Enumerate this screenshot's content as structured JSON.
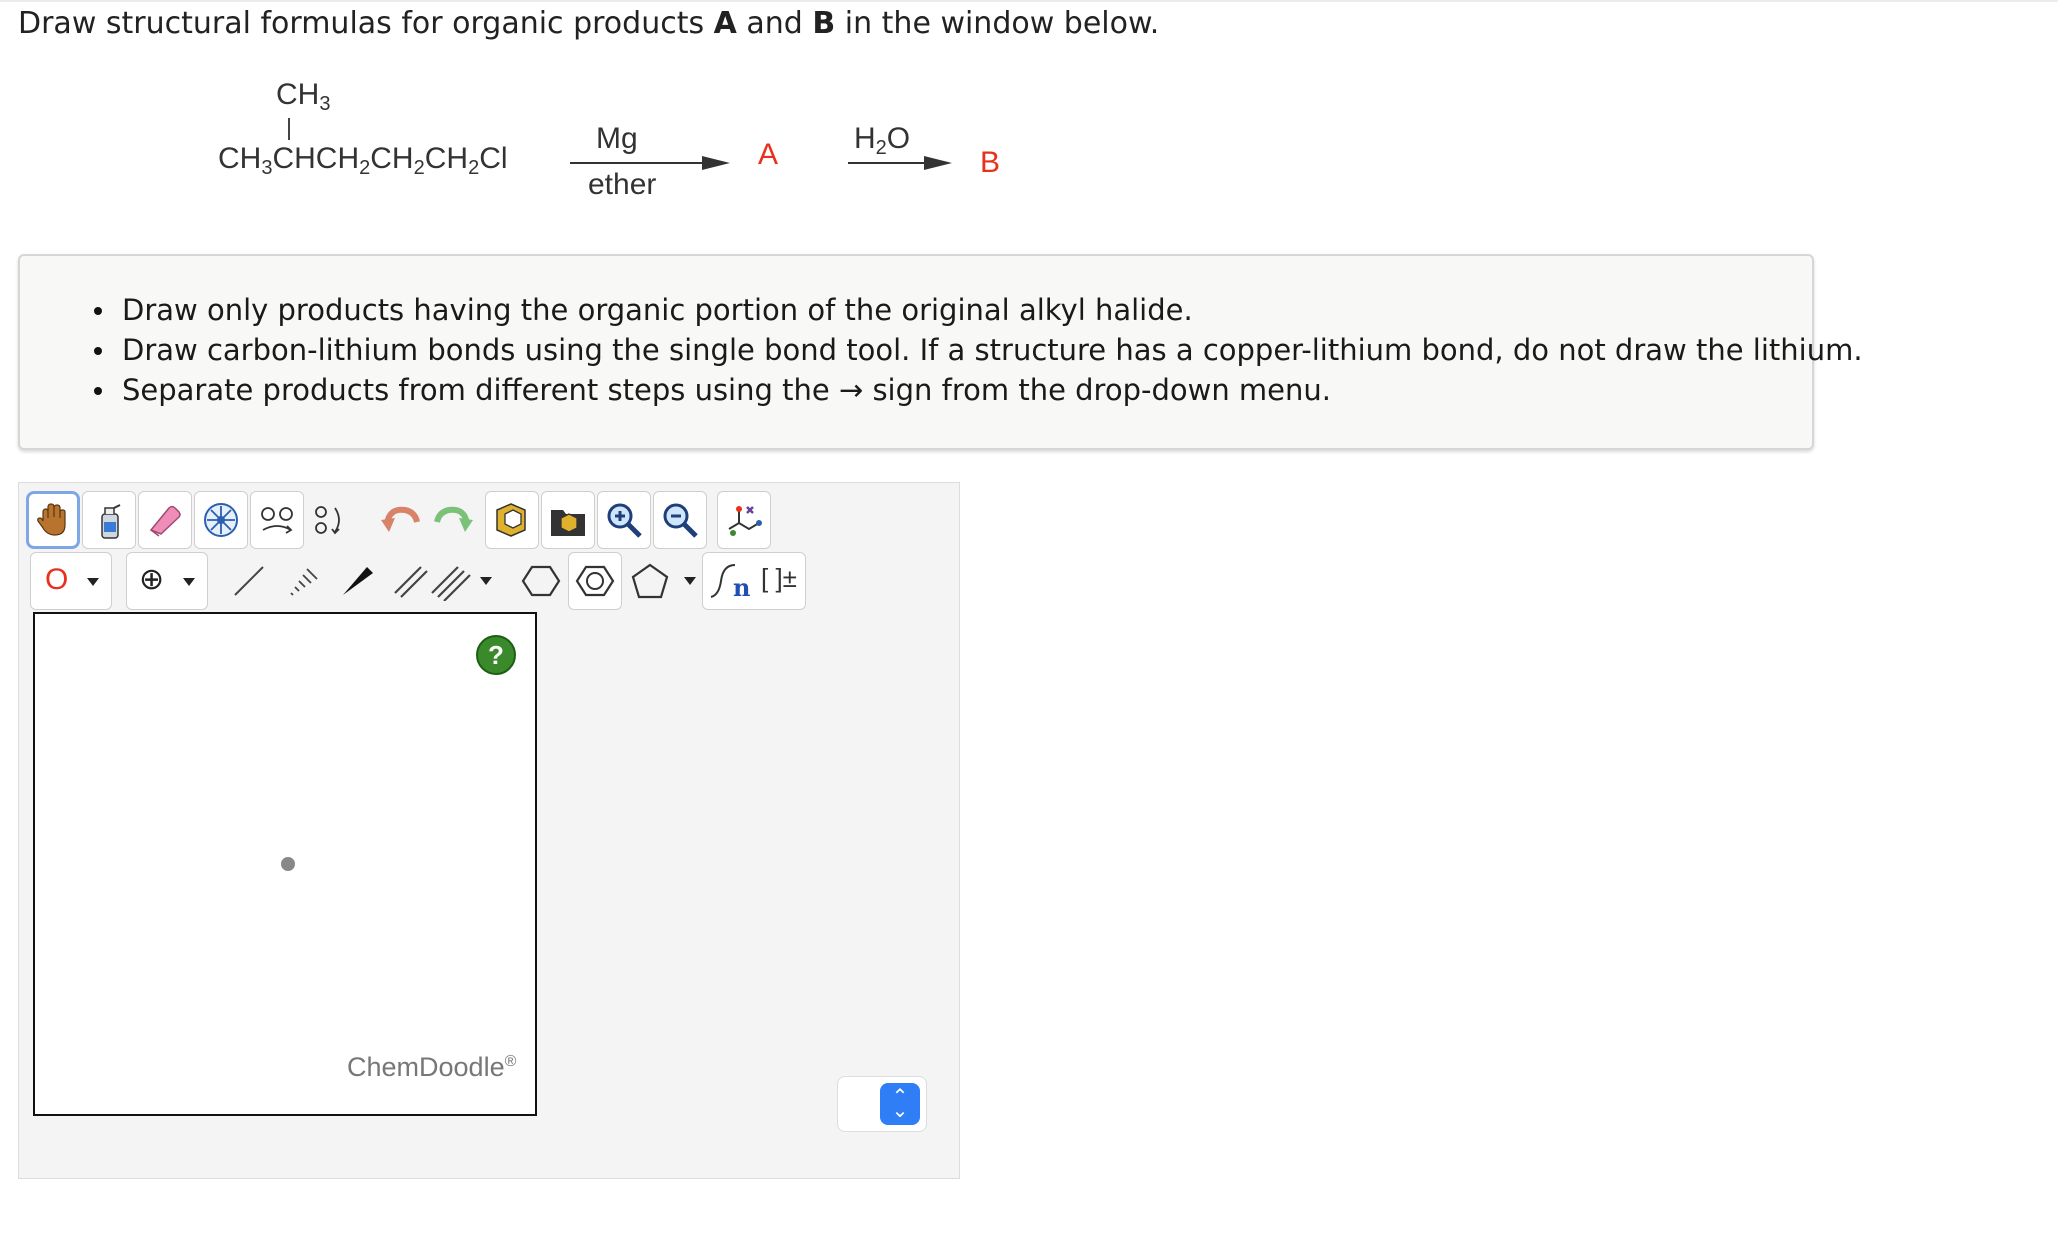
{
  "question": {
    "prefix": "Draw structural formulas for organic products ",
    "product_a": "A",
    "and": " and ",
    "product_b": "B",
    "suffix": " in the window below."
  },
  "reaction": {
    "branch_group": "CH",
    "branch_sub": "3",
    "chain_parts": [
      "CH",
      "3",
      "CHCH",
      "2",
      "CH",
      "2",
      "CH",
      "2",
      "Cl"
    ],
    "reagent1_top": "Mg",
    "reagent1_bottom": "ether",
    "product1": "A",
    "reagent2_h": "H",
    "reagent2_sub": "2",
    "reagent2_o": "O",
    "product2": "B"
  },
  "instructions": [
    "Draw only products having the organic portion of the original alkyl halide.",
    "Draw carbon-lithium bonds using the single bond tool. If a structure has a copper-lithium bond, do not draw the lithium.",
    "Separate products from different steps using the → sign from the drop-down menu."
  ],
  "editor": {
    "atom_label": "O",
    "charge_label": "⊕",
    "sgroup_n": "n",
    "bracket_label": "[ ]±",
    "help_label": "?",
    "brand": "ChemDoodle",
    "brand_mark": "®"
  },
  "colors": {
    "accent_red": "#e8301c",
    "help_green": "#3a8a2c",
    "updown_blue": "#2f7ef5",
    "selection_blue": "#7fa7e6"
  }
}
